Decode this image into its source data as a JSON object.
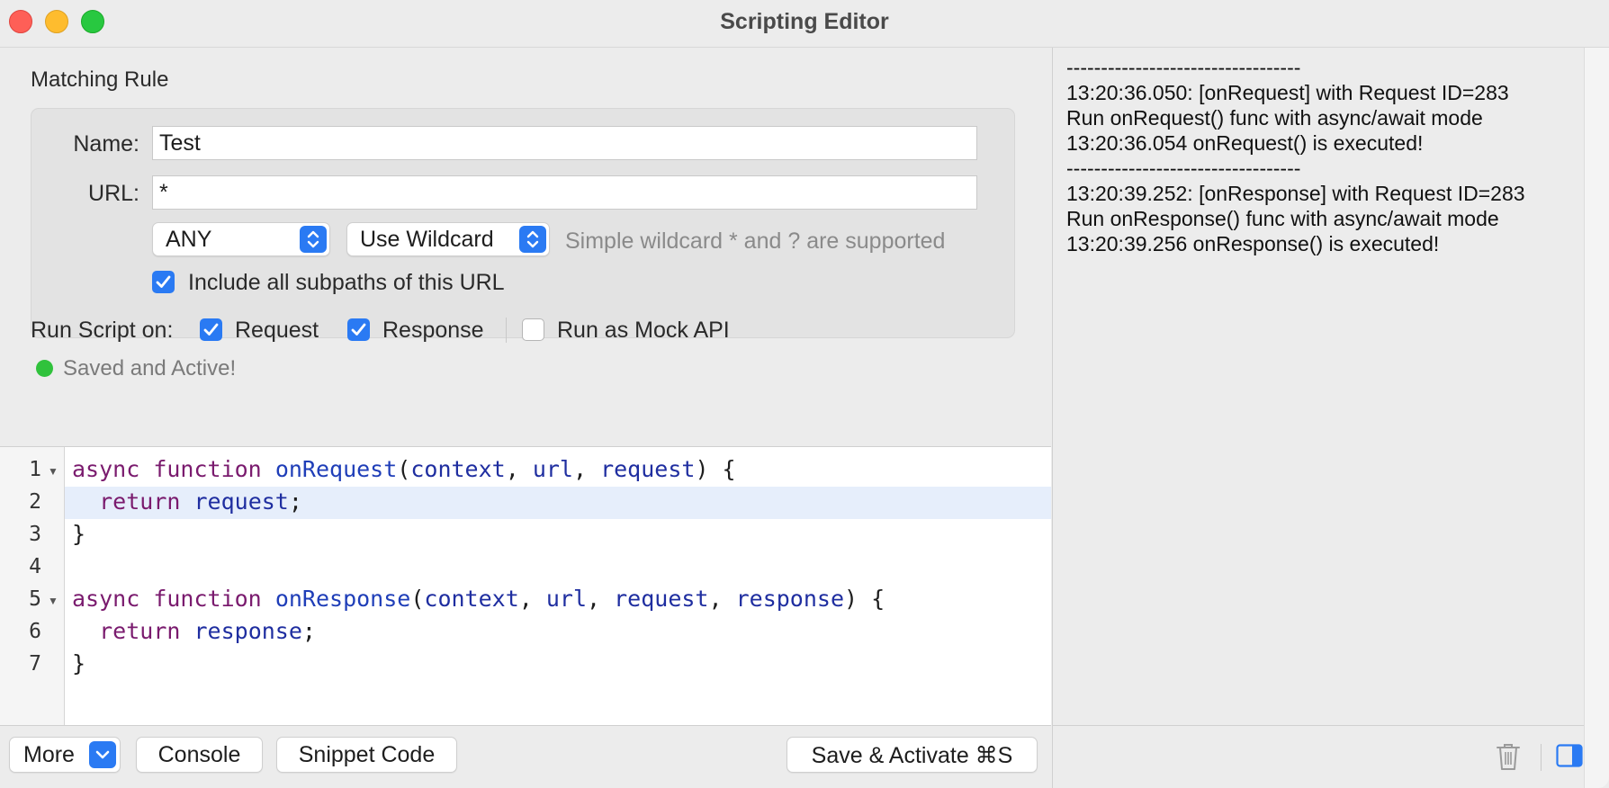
{
  "window": {
    "title": "Scripting Editor"
  },
  "rule": {
    "heading": "Matching Rule",
    "name_label": "Name:",
    "name_value": "Test",
    "url_label": "URL:",
    "url_value": "*",
    "method_value": "ANY",
    "match_mode_value": "Use Wildcard",
    "hint": "Simple wildcard * and ? are supported",
    "include_subpaths_label": "Include all subpaths of this URL",
    "include_subpaths_checked": true
  },
  "run_script": {
    "label": "Run Script on:",
    "request_label": "Request",
    "request_checked": true,
    "response_label": "Response",
    "response_checked": true,
    "mock_label": "Run as Mock API",
    "mock_checked": false
  },
  "status": {
    "text": "Saved and Active!",
    "color": "#30c23c"
  },
  "editor": {
    "line_numbers": [
      "1",
      "2",
      "3",
      "4",
      "5",
      "6",
      "7"
    ],
    "lines": [
      "async function onRequest(context, url, request) {",
      "  return request;",
      "}",
      "",
      "async function onResponse(context, url, request, response) {",
      "  return response;",
      "}"
    ]
  },
  "toolbar": {
    "more_label": "More",
    "console_label": "Console",
    "snippet_label": "Snippet Code",
    "save_label": "Save & Activate ⌘S"
  },
  "console_log": {
    "lines": [
      "----------------------------------",
      "13:20:36.050: [onRequest] with Request ID=283",
      "Run onRequest() func with async/await mode",
      "13:20:36.054 onRequest() is executed!",
      "----------------------------------",
      "13:20:39.252: [onResponse] with Request ID=283",
      "Run onResponse() func with async/await mode",
      "13:20:39.256 onResponse() is executed!"
    ]
  },
  "icons": {
    "trash": "trash-icon",
    "sidebar": "sidebar-toggle-icon"
  },
  "colors": {
    "accent": "#2a7af3"
  }
}
